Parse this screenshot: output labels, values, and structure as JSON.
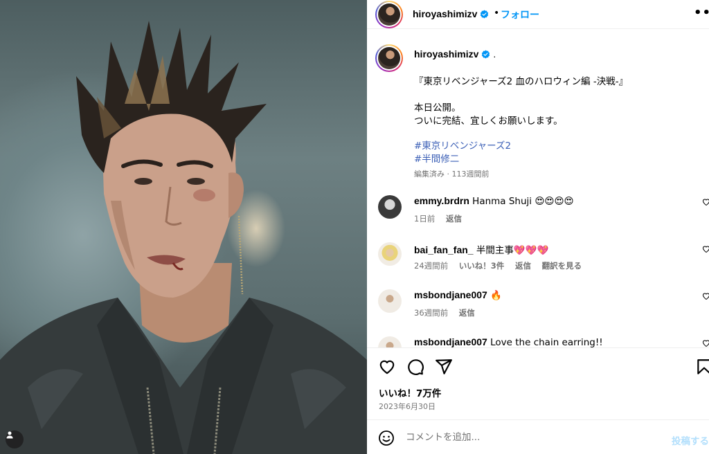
{
  "post": {
    "username": "hiroyashimizv",
    "follow_label": "フォロー",
    "header_dot": "•",
    "more_label": "•••"
  },
  "caption": {
    "username": "hiroyashimizv",
    "dot": ".",
    "line1": "『東京リベンジャーズ2 血のハロウィン編 -決戦-』",
    "line2": "本日公開。",
    "line3": "ついに完結、宜しくお願いします。",
    "hashtags": [
      "#東京リベンジャーズ2",
      "#半間修二"
    ],
    "meta": "編集済み · 113週間前"
  },
  "comments": [
    {
      "user": "emmy.brdrn",
      "text": "Hanma Shuji 😍😍😍😍",
      "time": "1日前",
      "likes": "",
      "reply": "返信",
      "translate": ""
    },
    {
      "user": "bai_fan_fan_",
      "text": "半間主事💖💖💖",
      "time": "24週間前",
      "likes": "いいね！3件",
      "reply": "返信",
      "translate": "翻訳を見る"
    },
    {
      "user": "msbondjane007",
      "text": "🔥",
      "time": "36週間前",
      "likes": "",
      "reply": "返信",
      "translate": ""
    },
    {
      "user": "msbondjane007",
      "text": "Love the chain earring!!",
      "time": "",
      "likes": "",
      "reply": "",
      "translate": ""
    }
  ],
  "footer": {
    "likes": "いいね！7万件",
    "date": "2023年6月30日",
    "input_placeholder": "コメントを追加...",
    "post_label": "投稿する"
  },
  "colors": {
    "accent": "#0095f6",
    "hashtag": "#3b5fb6",
    "muted": "#737373",
    "post_disabled": "#b2dffc"
  },
  "icons": [
    "verified-badge-icon",
    "more-options-icon",
    "heart-icon",
    "comment-icon",
    "share-icon",
    "bookmark-icon",
    "emoji-icon",
    "tag-user-icon"
  ]
}
